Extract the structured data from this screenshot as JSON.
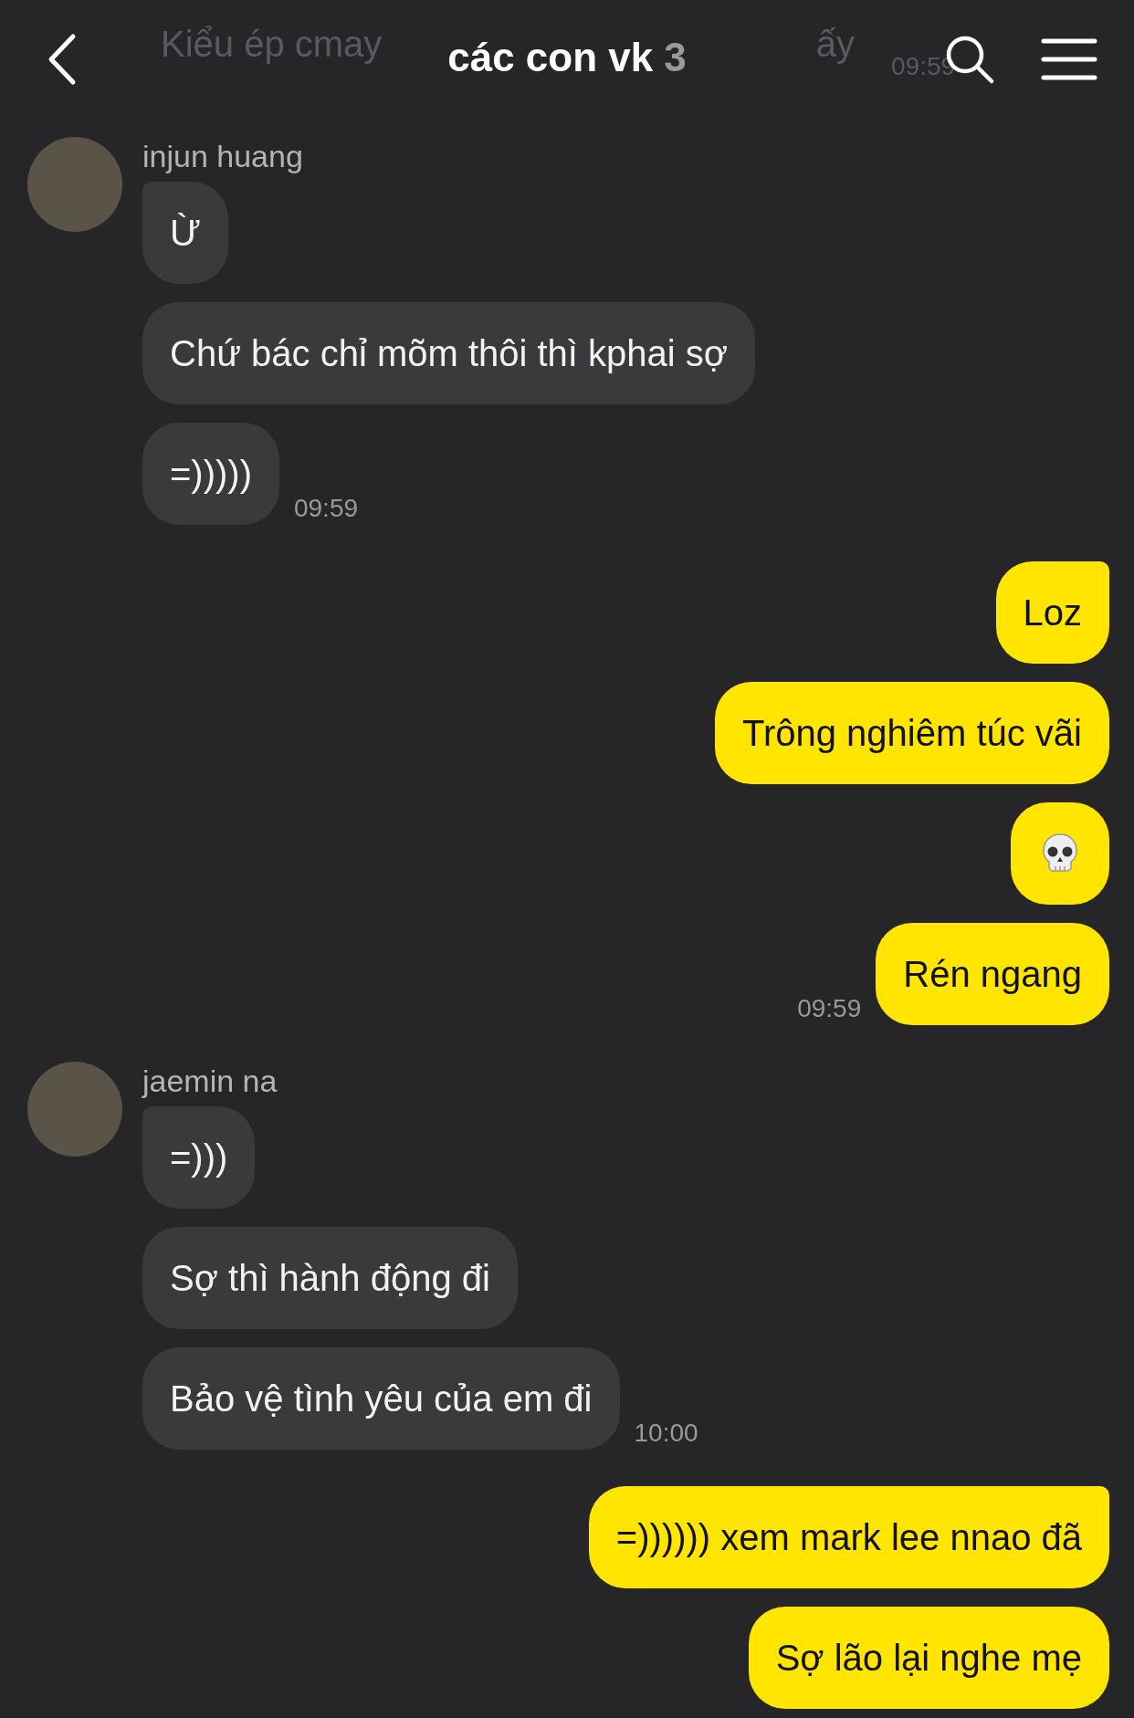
{
  "header": {
    "title": "các con vk",
    "member_count": "3",
    "faded_message": {
      "text_start": "Kiểu ép cmay",
      "text_end": "ấy",
      "time": "09:59"
    }
  },
  "groups": [
    {
      "kind": "incoming",
      "sender": "injun huang",
      "time": "09:59",
      "messages": [
        {
          "kind": "text",
          "text": "Ừ"
        },
        {
          "kind": "text",
          "text": "Chứ bác chỉ mõm thôi thì kphai sợ"
        },
        {
          "kind": "text",
          "text": "=)))))"
        }
      ]
    },
    {
      "kind": "outgoing",
      "time": "09:59",
      "messages": [
        {
          "kind": "text",
          "text": "Loz"
        },
        {
          "kind": "text",
          "text": "Trông nghiêm túc vãi"
        },
        {
          "kind": "skull"
        },
        {
          "kind": "text",
          "text": "Rén ngang"
        }
      ]
    },
    {
      "kind": "incoming",
      "sender": "jaemin na",
      "time": "10:00",
      "messages": [
        {
          "kind": "text",
          "text": "=)))"
        },
        {
          "kind": "text",
          "text": "Sợ thì hành động đi"
        },
        {
          "kind": "text",
          "text": "Bảo vệ tình yêu của em đi"
        }
      ]
    },
    {
      "kind": "outgoing",
      "messages": [
        {
          "kind": "text",
          "text": "=)))))) xem mark lee nnao đã"
        },
        {
          "kind": "text",
          "text": "Sợ lão lại nghe mẹ"
        }
      ]
    }
  ]
}
